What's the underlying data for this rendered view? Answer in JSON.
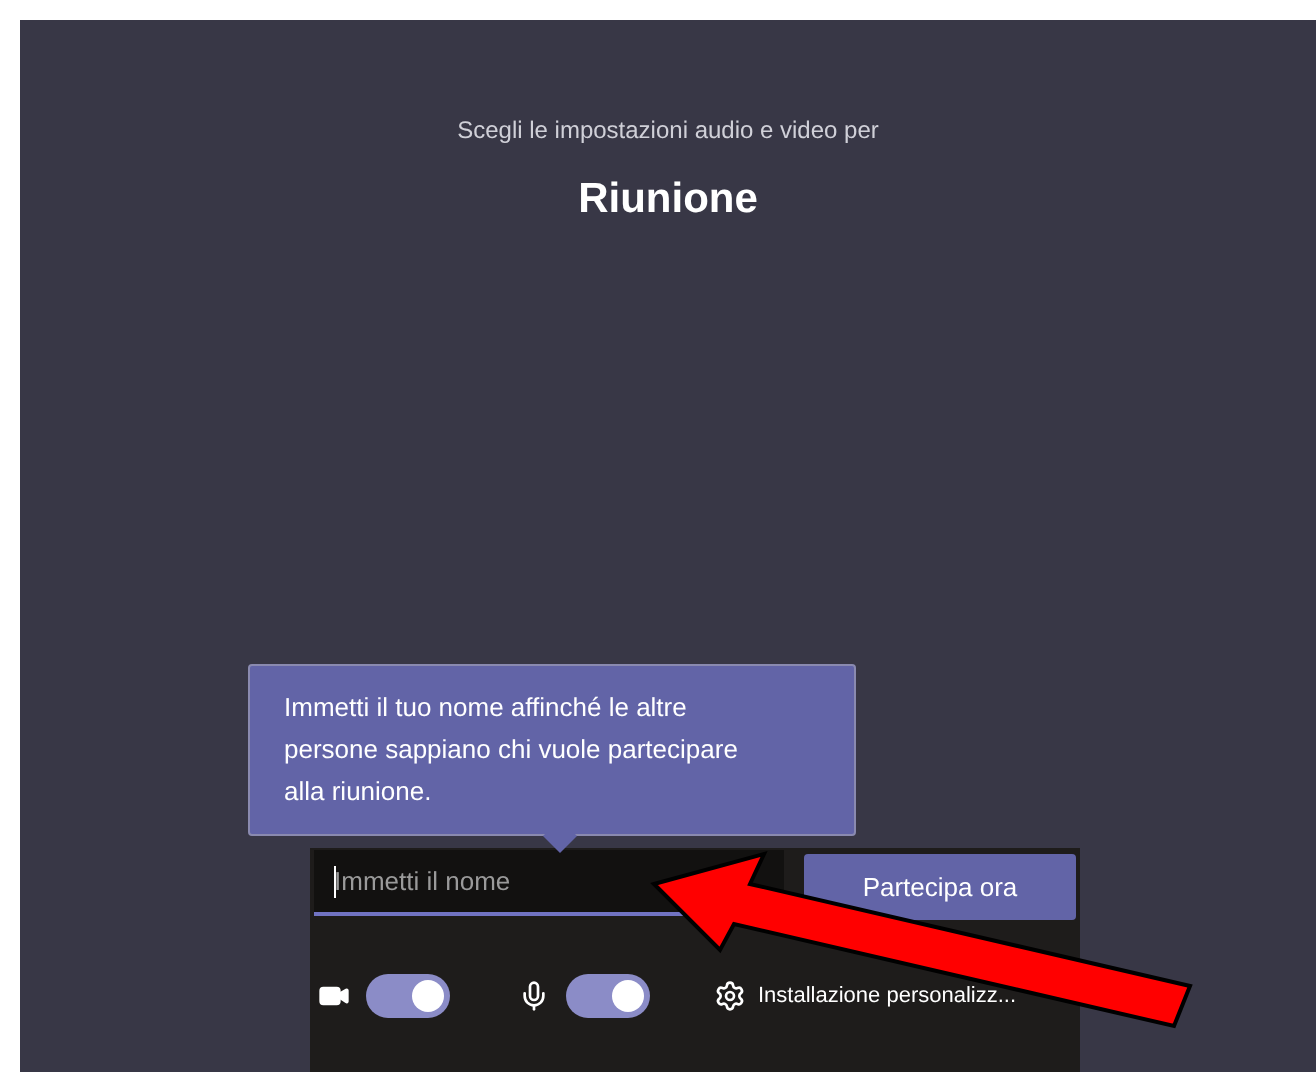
{
  "header": {
    "subtitle": "Scegli le impostazioni audio e video per",
    "title": "Riunione"
  },
  "tooltip": {
    "text": "Immetti il tuo nome affinché le altre persone sappiano chi vuole partecipare alla riunione."
  },
  "name_field": {
    "placeholder": "Immetti il nome"
  },
  "join_button": {
    "label": "Partecipa ora"
  },
  "controls": [
    {
      "kind": "camera",
      "on": true
    },
    {
      "kind": "microphone",
      "on": true
    }
  ],
  "settings": {
    "label": "Installazione personalizz..."
  }
}
